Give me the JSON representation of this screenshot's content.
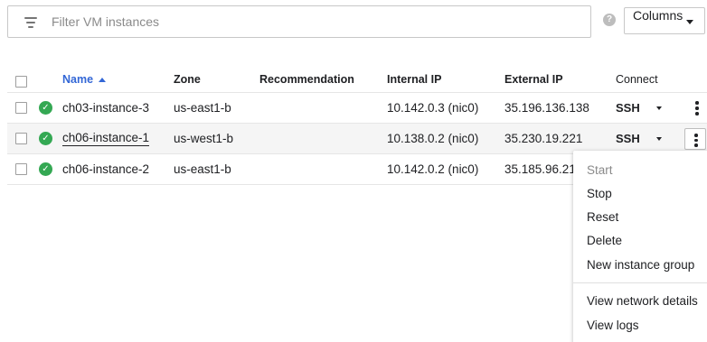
{
  "filter": {
    "placeholder": "Filter VM instances"
  },
  "help": {
    "glyph": "?"
  },
  "columns_button": {
    "label": "Columns"
  },
  "table": {
    "headers": {
      "name": "Name",
      "zone": "Zone",
      "recommendation": "Recommendation",
      "internal_ip": "Internal IP",
      "external_ip": "External IP",
      "connect": "Connect"
    },
    "rows": [
      {
        "name": "ch03-instance-3",
        "zone": "us-east1-b",
        "recommendation": "",
        "internal_ip": "10.142.0.3 (nic0)",
        "external_ip": "35.196.136.138",
        "connect": "SSH",
        "status": "running"
      },
      {
        "name": "ch06-instance-1",
        "zone": "us-west1-b",
        "recommendation": "",
        "internal_ip": "10.138.0.2 (nic0)",
        "external_ip": "35.230.19.221",
        "connect": "SSH",
        "status": "running"
      },
      {
        "name": "ch06-instance-2",
        "zone": "us-east1-b",
        "recommendation": "",
        "internal_ip": "10.142.0.2 (nic0)",
        "external_ip": "35.185.96.21",
        "connect": "SSH",
        "status": "running"
      }
    ]
  },
  "menu": {
    "items": [
      {
        "label": "Start",
        "enabled": false
      },
      {
        "label": "Stop",
        "enabled": true
      },
      {
        "label": "Reset",
        "enabled": true
      },
      {
        "label": "Delete",
        "enabled": true
      },
      {
        "label": "New instance group",
        "enabled": true
      },
      {
        "label": "View network details",
        "enabled": true
      },
      {
        "label": "View logs",
        "enabled": true
      }
    ]
  },
  "colors": {
    "accent": "#3367d6",
    "status_ok": "#34a853"
  },
  "icons": {
    "filter": "filter-lines-icon",
    "help": "help-circle-icon",
    "status": "check-circle-icon",
    "more": "more-vert-icon",
    "dropdown": "caret-down-icon"
  }
}
